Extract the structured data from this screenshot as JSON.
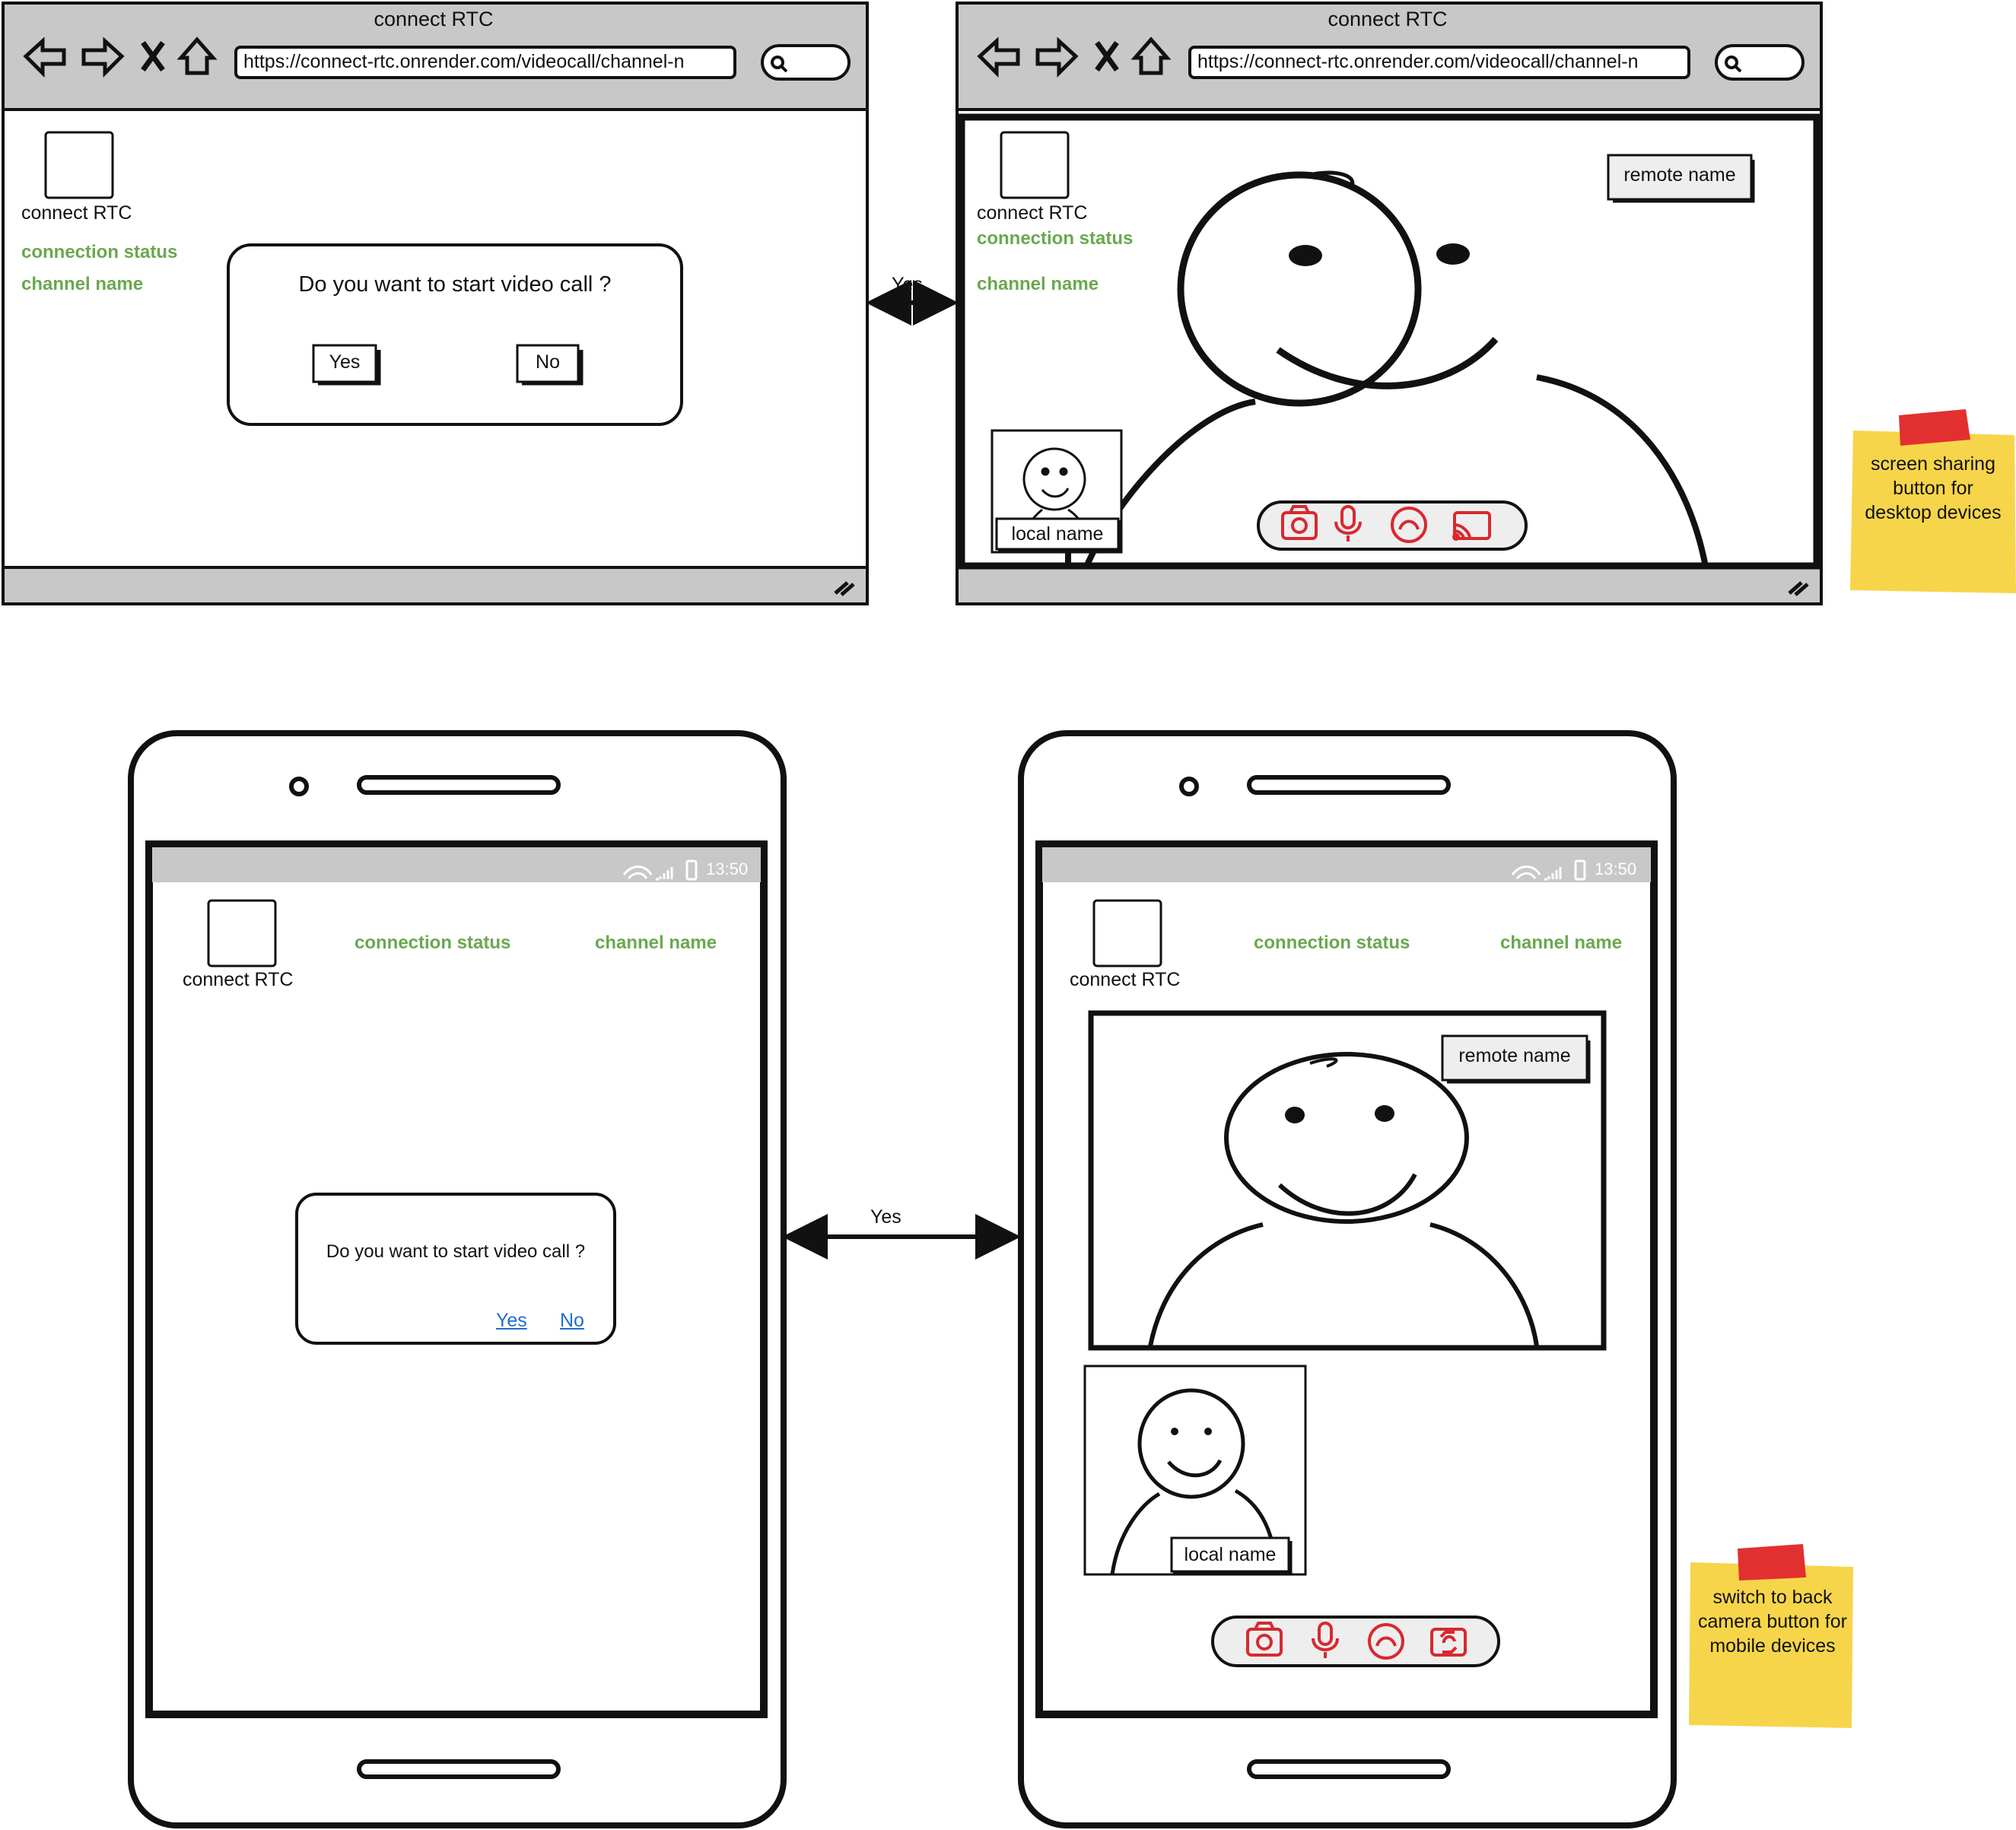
{
  "browser": {
    "title": "connect RTC",
    "url": "https://connect-rtc.onrender.com/videocall/channel-n"
  },
  "app": {
    "brand": "connect RTC",
    "connection_status": "connection status",
    "channel_name": "channel name"
  },
  "dialog": {
    "question": "Do you want to start video call ?",
    "yes": "Yes",
    "no": "No"
  },
  "call": {
    "remote_name": "remote name",
    "local_name": "local name",
    "controls": [
      "camera-icon",
      "microphone-icon",
      "hang-up-icon",
      "screen-share-icon"
    ],
    "mobile_controls": [
      "camera-icon",
      "microphone-icon",
      "hang-up-icon",
      "switch-camera-icon"
    ]
  },
  "phone": {
    "status_time": "13:50"
  },
  "arrows": {
    "top_label": "Yes",
    "bottom_label": "Yes"
  },
  "notes": {
    "desktop": "screen sharing button for desktop devices",
    "mobile": "switch to back camera button for mobile devices"
  },
  "colors": {
    "accent_green": "#6aa84f",
    "control_red": "#d9282f",
    "link_blue": "#1f6fd1",
    "sticky_yellow": "#f7d54a",
    "chrome_gray": "#c8c8c8"
  }
}
